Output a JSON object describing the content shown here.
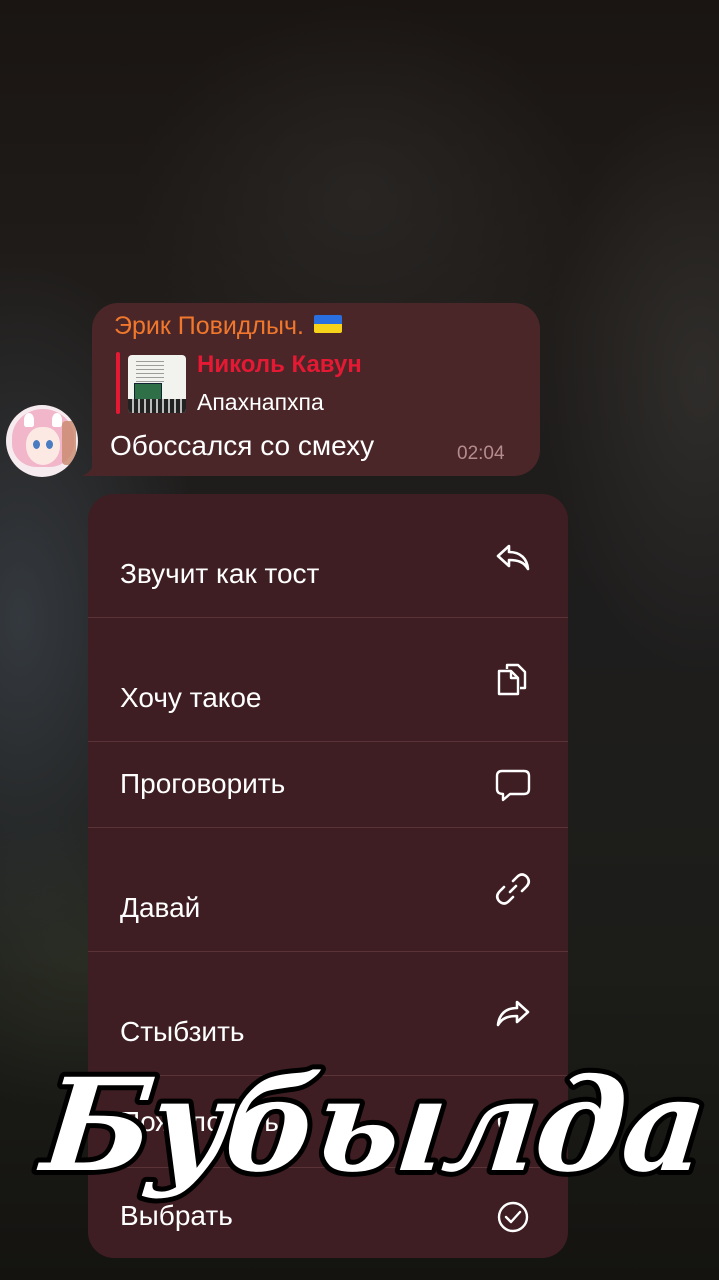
{
  "message": {
    "sender": "Эрик Повидлыч.",
    "sender_flag": "ukraine-flag",
    "reply": {
      "name": "Николь Кавун",
      "text": "Апахнапхпа"
    },
    "text": "Обоссался со смеху",
    "time": "02:04"
  },
  "menu": {
    "items": [
      {
        "label": "Звучит как тост",
        "icon": "reply-icon"
      },
      {
        "label": "Хочу такое",
        "icon": "copy-icon"
      },
      {
        "label": "Проговорить",
        "icon": "comment-icon"
      },
      {
        "label": "Давай",
        "icon": "link-icon"
      },
      {
        "label": "Стыбзить",
        "icon": "forward-icon"
      },
      {
        "label": "Пожаловаться",
        "icon": "report-icon"
      },
      {
        "label": "Выбрать",
        "icon": "select-icon"
      }
    ]
  },
  "watermark": {
    "text": "Бубылда"
  },
  "colors": {
    "sender": "#f0772c",
    "reply_accent": "#e51933",
    "bubble": "#4a2628",
    "menu": "#3e1e22"
  }
}
